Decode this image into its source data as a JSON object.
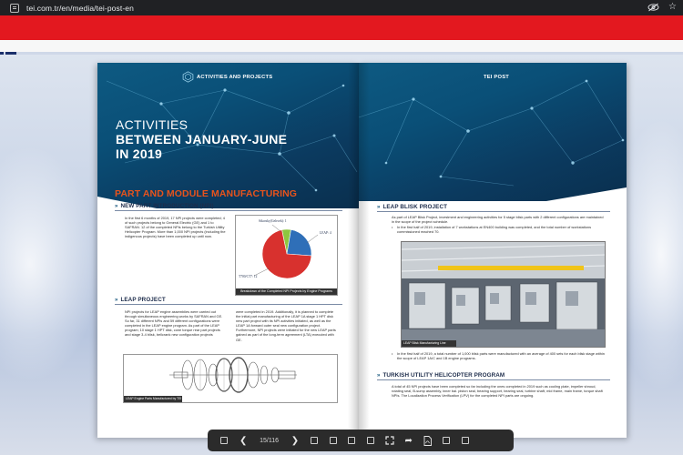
{
  "browser": {
    "url": "tei.com.tr/en/media/tei-post-en"
  },
  "book": {
    "left_page": {
      "section_label": "ACTIVITIES AND PROJECTS",
      "title_line1": "ACTIVITIES",
      "title_line2": "BETWEEN JANUARY-JUNE",
      "title_line3": "IN 2019",
      "main_heading": "PART AND MODULE MANUFACTURING",
      "npi_heading": "NEW PART INTRODUCTION (NPI)",
      "npi_text": "In the first 6 months of 2019, 17 NPI projects were completed; 4 of such projects belong to General Electric (GE) and 1 to SAFRAN. 12 of the completed NPIs belong to the Turkish Utility Helicopter Program. More than 1,000 NPI projects (including the indigenous projects) have been completed up until now.",
      "pie": {
        "label_left_top": "Sikorsky(Gelecek): 1",
        "label_right": "LEAP: 4",
        "label_left_bottom": "T700/CT7: 12",
        "caption": "Breakdown of the Completed NPI Projects by Engine Programs"
      },
      "leap_heading": "LEAP PROJECT",
      "leap_text_col1": "NPI projects for LEAP engine assemblies were carried out through simultaneous engineering works by SAFRAN and GE. So far, 31 different NPIs and 59 different configurations were completed in the LEAP engine program. As part of the LEAP program; 10 stage 1 HPT disk, cone torque rear part projects and stage 3-4 blisk, bellcrank new configuration projects",
      "leap_text_col2": "were completed in 2019. Additionally, it is planned to complete the initial part manufacturing of the LEAP 1A stage 1 HPT disk new part project with its NPI activities initiated, as well as the LEAP 1A forward outer seal new configuration project. Furthermore, NPI projects were initiated for the new LEAP parts gained as part of the long-term agreement (LTA) executed with GE.",
      "engine_caption": "LEAP Engine Parts Manufactured by TEI"
    },
    "right_page": {
      "section_label": "TEI POST",
      "blisk_heading": "LEAP BLISK PROJECT",
      "blisk_text": "As part of LEAP Blisk Project, investment and engineering activities for 5 stage blisk parts with 2 different configurations are maintained in the scope of the project schedule.",
      "blisk_bullet1": "In the first half of 2019, installation of 7 workstations at EN400 building was completed, and the total number of workstations commissioned reached 70.",
      "photo_caption": "LEAP Blisk Manufacturing Line",
      "blisk_bullet2": "In the first half of 2019, a total number of 1,000 blisk parts were manufactured with an average of 400 sets for each blisk stage within the scope of LEAP 1A/C and 1B engine programs.",
      "tuh_heading": "TURKISH UTILITY HELICOPTER PROGRAM",
      "tuh_text": "A total of 45 NPI projects have been completed so far including the ones completed in 2019 such as cooling plate, impeller shroud, rotating seal, B-sump assembly, inner bal. piston seal, bearing support, bearing seal, turbine shaft, mid frame, main frame, torque shaft NPIs. The Localization Process Verification (LPV) for the completed NPI parts are ongoing."
    },
    "chart_data": {
      "type": "pie",
      "title": "Breakdown of the Completed NPI Projects by Engine Programs",
      "categories": [
        "T700/CT7",
        "LEAP",
        "Sikorsky(Gelecek)"
      ],
      "values": [
        12,
        4,
        1
      ],
      "colors": [
        "#d8312e",
        "#2f6fb8",
        "#8dc63f"
      ]
    }
  },
  "toolbar": {
    "page_indicator": "15/116"
  },
  "colors": {
    "url_bar": "#202124",
    "red_banner": "#e3181f",
    "hero_blue": "#0a4f77",
    "heading_orange": "#e8531c",
    "toolbar": "#2b2b2b"
  }
}
